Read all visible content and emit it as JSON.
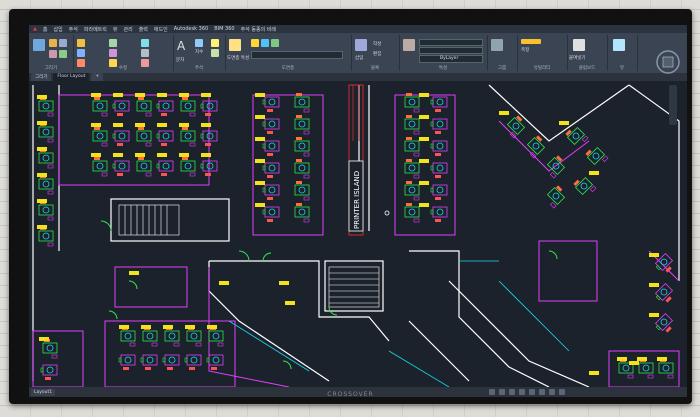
{
  "app": {
    "title": "Autodesk 360",
    "title_tabs": [
      "홈",
      "삽입",
      "주석",
      "파라메트릭",
      "뷰",
      "관리",
      "출력",
      "애드인",
      "BIM 360",
      "주석 동종의 비례"
    ]
  },
  "ribbon": {
    "panels": [
      {
        "title": "그리기"
      },
      {
        "title": "수정"
      },
      {
        "title": "주석"
      },
      {
        "title": "도면층"
      },
      {
        "title": "블록"
      },
      {
        "title": "특성"
      },
      {
        "title": "그룹"
      },
      {
        "title": "유틸리티"
      },
      {
        "title": "클립보드"
      },
      {
        "title": "뷰"
      }
    ],
    "labels": {
      "text": "문자",
      "dimension": "치수",
      "insert": "삽입",
      "layer_props": "도면층 특성",
      "create": "작성",
      "edit": "편집",
      "paste": "붙여넣기",
      "bylayer": "ByLayer",
      "measure": "측정"
    }
  },
  "tabs": [
    {
      "label": "그리기"
    },
    {
      "label": "Floor Layout"
    }
  ],
  "canvas": {
    "printer_island_label": "PRINTER ISLAND"
  },
  "status": {
    "layout_tab": "Layout1"
  },
  "monitor": {
    "brand": "CROSSOVER"
  },
  "colors": {
    "wall": "#ffffff",
    "magenta": "#e040fb",
    "green": "#2ee84a",
    "cyan": "#19d8e8",
    "yellow": "#f2e21a",
    "red": "#ff2f2f",
    "background": "#1b222c"
  }
}
